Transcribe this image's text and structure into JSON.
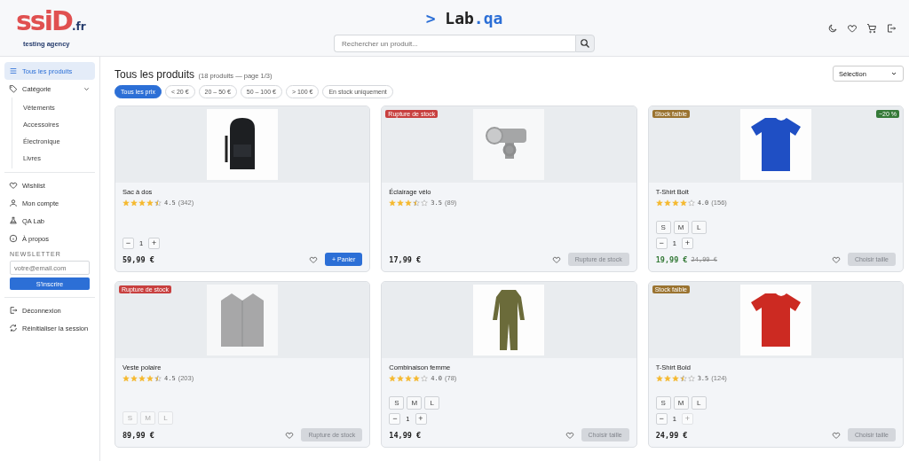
{
  "header": {
    "logo": {
      "mark": "ssiD",
      "suffix": ".fr",
      "tagline": "testing agency"
    },
    "title": {
      "prompt": ">",
      "name": "Lab",
      "ext": ".qa"
    },
    "search": {
      "placeholder": "Rechercher un produit..."
    }
  },
  "sidebar": {
    "items": [
      {
        "label": "Tous les produits",
        "selected": true
      },
      {
        "label": "Catégorie",
        "selected": false,
        "expanded": true,
        "children": [
          {
            "label": "Vêtements"
          },
          {
            "label": "Accessoires"
          },
          {
            "label": "Électronique"
          },
          {
            "label": "Livres"
          }
        ]
      }
    ],
    "links": [
      {
        "label": "Wishlist"
      },
      {
        "label": "Mon compte"
      },
      {
        "label": "QA Lab"
      },
      {
        "label": "À propos"
      }
    ],
    "newsletter": {
      "heading": "NEWSLETTER",
      "placeholder": "votre@email.com",
      "button": "S'inscrire"
    },
    "footer_links": [
      {
        "label": "Déconnexion"
      },
      {
        "label": "Réinitialiser la session"
      }
    ]
  },
  "page": {
    "title": "Tous les produits",
    "subtitle": "(18 produits — page 1/3)",
    "sort": "Sélection",
    "filters": [
      {
        "label": "Tous les prix",
        "selected": true
      },
      {
        "label": "< 20 €",
        "selected": false
      },
      {
        "label": "20 – 50 €",
        "selected": false
      },
      {
        "label": "50 – 100 €",
        "selected": false
      },
      {
        "label": "> 100 €",
        "selected": false
      },
      {
        "label": "En stock uniquement",
        "selected": false
      }
    ]
  },
  "products": [
    {
      "name": "Sac à dos",
      "stars": 4.5,
      "rating": "4.5",
      "reviews": "(342)",
      "quantity": {
        "minus": "−",
        "value": "1",
        "plus": "+",
        "plus_disabled": false
      },
      "price": "59,99 €",
      "button": "+ Panier",
      "button_enabled": true
    },
    {
      "name": "Éclairage vélo",
      "stars": 3.5,
      "rating": "3.5",
      "reviews": "(89)",
      "stock_badge": {
        "label": "Rupture de stock",
        "kind": "out"
      },
      "price": "17,99 €",
      "button": "Rupture de stock",
      "button_enabled": false
    },
    {
      "name": "T-Shirt Bolt",
      "stars": 4,
      "rating": "4.0",
      "reviews": "(156)",
      "stock_badge": {
        "label": "Stock faible",
        "kind": "low"
      },
      "discount": "−20 %",
      "sizes": [
        {
          "label": "S",
          "disabled": false
        },
        {
          "label": "M",
          "disabled": false
        },
        {
          "label": "L",
          "disabled": false
        }
      ],
      "quantity": {
        "minus": "−",
        "value": "1",
        "plus": "+",
        "plus_disabled": false
      },
      "price": "19,99 €",
      "old_price": "24,99 €",
      "button": "Choisir taille",
      "button_enabled": false
    },
    {
      "name": "Veste polaire",
      "stars": 4.5,
      "rating": "4.5",
      "reviews": "(203)",
      "stock_badge": {
        "label": "Rupture de stock",
        "kind": "out"
      },
      "sizes": [
        {
          "label": "S",
          "disabled": true
        },
        {
          "label": "M",
          "disabled": true
        },
        {
          "label": "L",
          "disabled": true
        }
      ],
      "price": "89,99 €",
      "button": "Rupture de stock",
      "button_enabled": false
    },
    {
      "name": "Combinaison femme",
      "stars": 4,
      "rating": "4.0",
      "reviews": "(78)",
      "sizes": [
        {
          "label": "S",
          "disabled": false
        },
        {
          "label": "M",
          "disabled": false
        },
        {
          "label": "L",
          "disabled": false
        }
      ],
      "quantity": {
        "minus": "−",
        "value": "1",
        "plus": "+",
        "plus_disabled": false
      },
      "price": "14,99 €",
      "button": "Choisir taille",
      "button_enabled": false
    },
    {
      "name": "T-Shirt Bold",
      "stars": 3.5,
      "rating": "3.5",
      "reviews": "(124)",
      "stock_badge": {
        "label": "Stock faible",
        "kind": "low"
      },
      "sizes": [
        {
          "label": "S",
          "disabled": false
        },
        {
          "label": "M",
          "disabled": false
        },
        {
          "label": "L",
          "disabled": false
        }
      ],
      "quantity": {
        "minus": "−",
        "value": "1",
        "plus": "+",
        "plus_disabled": true
      },
      "price": "24,99 €",
      "button": "Choisir taille",
      "button_enabled": false
    }
  ]
}
